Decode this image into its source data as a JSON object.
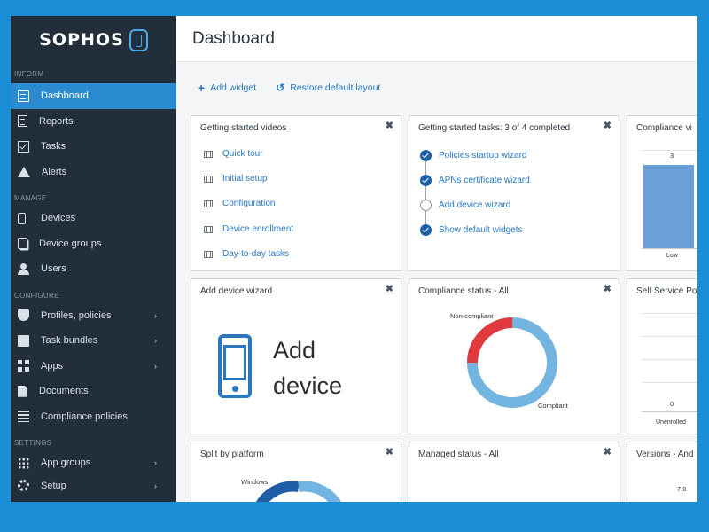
{
  "brand": {
    "name": "SOPHOS"
  },
  "colors": {
    "accent": "#2b8bd0",
    "sidebar": "#222f3b",
    "frame_border": "#1a8fd6",
    "noncompliant": "#e0393e",
    "compliant": "#74b4e0",
    "link": "#2a77bc"
  },
  "sidebar": {
    "sections": [
      {
        "label": "INFORM",
        "items": [
          {
            "label": "Dashboard",
            "icon": "dashboard-icon",
            "active": true
          },
          {
            "label": "Reports",
            "icon": "reports-icon"
          },
          {
            "label": "Tasks",
            "icon": "tasks-icon"
          },
          {
            "label": "Alerts",
            "icon": "alert-icon"
          }
        ]
      },
      {
        "label": "MANAGE",
        "items": [
          {
            "label": "Devices",
            "icon": "phone-icon"
          },
          {
            "label": "Device groups",
            "icon": "device-groups-icon"
          },
          {
            "label": "Users",
            "icon": "user-icon"
          }
        ]
      },
      {
        "label": "CONFIGURE",
        "items": [
          {
            "label": "Profiles, policies",
            "icon": "shield-icon",
            "has_submenu": true
          },
          {
            "label": "Task bundles",
            "icon": "bundle-icon",
            "has_submenu": true
          },
          {
            "label": "Apps",
            "icon": "apps-icon",
            "has_submenu": true
          },
          {
            "label": "Documents",
            "icon": "document-icon"
          },
          {
            "label": "Compliance policies",
            "icon": "list-icon"
          }
        ]
      },
      {
        "label": "SETTINGS",
        "items": [
          {
            "label": "App groups",
            "icon": "grid-icon",
            "has_submenu": true
          },
          {
            "label": "Setup",
            "icon": "gear-icon",
            "has_submenu": true
          }
        ]
      }
    ]
  },
  "header": {
    "title": "Dashboard"
  },
  "toolbar": {
    "add_widget": "Add widget",
    "restore_layout": "Restore default layout"
  },
  "widgets": {
    "getting_started_videos": {
      "title": "Getting started videos",
      "links": [
        "Quick tour",
        "Initial setup",
        "Configuration",
        "Device enrollment",
        "Day-to-day tasks"
      ]
    },
    "getting_started_tasks": {
      "title": "Getting started tasks: 3 of 4 completed",
      "tasks": [
        {
          "label": "Policies startup wizard",
          "done": true
        },
        {
          "label": "APNs certificate wizard",
          "done": true
        },
        {
          "label": "Add device wizard",
          "done": false
        },
        {
          "label": "Show default widgets",
          "done": true
        }
      ]
    },
    "compliance_view": {
      "title": "Compliance vi",
      "bar_value": "3",
      "bar_category": "Low"
    },
    "add_device_wizard": {
      "title": "Add device wizard",
      "text_line1": "Add",
      "text_line2": "device"
    },
    "compliance_status": {
      "title": "Compliance status - All",
      "label_noncompliant": "Non-compliant",
      "label_compliant": "Compliant",
      "noncompliant_fraction": 0.25
    },
    "self_service": {
      "title": "Self Service Po",
      "value": "0",
      "category": "Unenrolled"
    },
    "split_by_platform": {
      "title": "Split by platform",
      "label": "Windows"
    },
    "managed_status": {
      "title": "Managed status - All"
    },
    "versions": {
      "title": "Versions - And",
      "value": "7.0"
    }
  },
  "close_glyph": "✖"
}
